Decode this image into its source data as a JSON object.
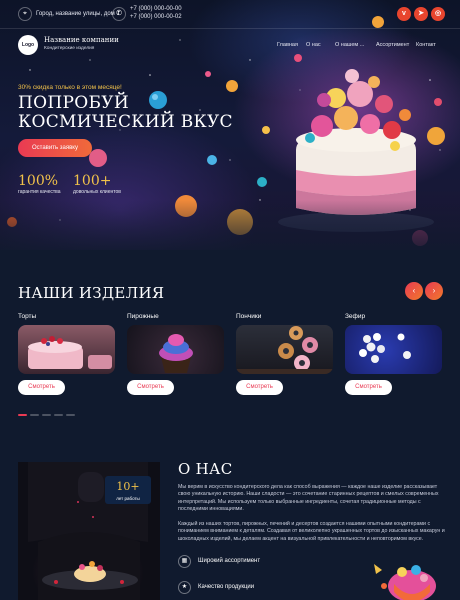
{
  "topbar": {
    "address": "Город, название улицы, дом 1",
    "phones": [
      "+7 (000) 000-00-00",
      "+7 (000) 000-00-02"
    ],
    "social": [
      "vk",
      "tg",
      "ig"
    ]
  },
  "brand": {
    "logo_text": "Logo",
    "name": "Название компании",
    "tagline": "Кондитерские изделия"
  },
  "nav": [
    "Главная",
    "О нас",
    "О нашем ...",
    "Ассортимент",
    "Контакт"
  ],
  "hero": {
    "promo": "30% скидка только в этом месяце!",
    "title_line1": "ПОПРОБУЙ",
    "title_line2": "КОСМИЧЕСКИЙ ВКУС",
    "cta": "Оставить заявку",
    "stats": [
      {
        "num": "100%",
        "label": "гарантия качества"
      },
      {
        "num": "100+",
        "label": "довольных клиентов"
      }
    ]
  },
  "products": {
    "title": "НАШИ ИЗДЕЛИЯ",
    "prev": "‹",
    "next": "›",
    "button": "Смотреть",
    "items": [
      {
        "title": "Торты",
        "image": "cake-image"
      },
      {
        "title": "Пирожные",
        "image": "cupcake-image"
      },
      {
        "title": "Пончики",
        "image": "donuts-image"
      },
      {
        "title": "Зефир",
        "image": "marshmallow-image"
      }
    ]
  },
  "about": {
    "title": "О НАС",
    "badge_num": "10+",
    "badge_label": "лет работы",
    "para1": "Мы верим в искусство кондитерского дела как способ выражения — каждое наше изделие рассказывает свою уникальную историю. Наши сладости — это сочетание старинных рецептов и смелых современных интерпретаций. Мы используем только выбранные ингредиенты, сочетая традиционные методы с последними инновациями.",
    "para2": "Каждый из наших тортов, пирожных, печений и десертов создается нашими опытными кондитерами с пониманием вниманием к деталям. Создавая от великолепно украшенных тортов до изысканных макарун и шоколадных изделий, мы делаем акцент на визуальной привлекательности и неповторимом вкусе.",
    "features": [
      "Широкий ассортимент",
      "Качество продукции"
    ]
  },
  "colors": {
    "accent": "#e93a53",
    "gold": "#f1c24a",
    "background": "#101a2e"
  }
}
